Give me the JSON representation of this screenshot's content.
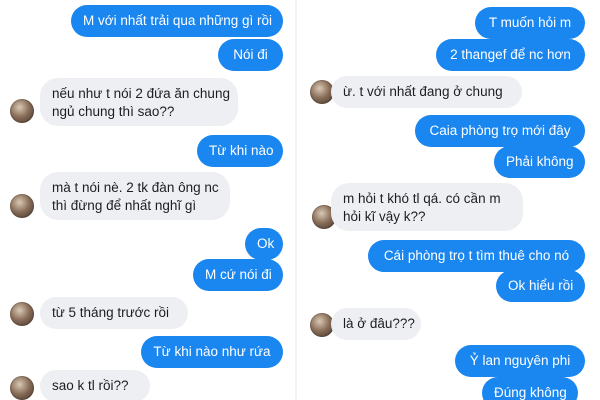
{
  "left_conversation": {
    "messages": [
      {
        "sender": "me",
        "text": "M với nhất trải qua những gì rồi"
      },
      {
        "sender": "me",
        "text": "Nói đi"
      },
      {
        "sender": "them",
        "lines": [
          "nếu như t nói 2 đứa ăn chung",
          "ngủ chung thì sao??"
        ]
      },
      {
        "sender": "me",
        "text": "Từ khi nào"
      },
      {
        "sender": "them",
        "lines": [
          "mà t nói nè. 2 tk đàn ông nc",
          "thì đừng để nhất nghĩ gì"
        ]
      },
      {
        "sender": "me",
        "text": "Ok"
      },
      {
        "sender": "me",
        "text": "M cứ nói đi"
      },
      {
        "sender": "them",
        "text": "từ 5 tháng trước rồi"
      },
      {
        "sender": "me",
        "text": "Từ khi nào như rứa"
      },
      {
        "sender": "them",
        "text": "sao k tl rồi??"
      }
    ]
  },
  "right_conversation": {
    "messages": [
      {
        "sender": "me",
        "text": "T muốn hỏi m"
      },
      {
        "sender": "me",
        "text": "2 thangef để nc hơn"
      },
      {
        "sender": "them",
        "text": "ừ. t với nhất đang ở chung"
      },
      {
        "sender": "me",
        "text": "Caia phòng trọ mới đây"
      },
      {
        "sender": "me",
        "text": "Phải không"
      },
      {
        "sender": "them",
        "lines": [
          "m hỏi t khó tl qá. có cần m",
          "hỏi kĩ vậy k??"
        ]
      },
      {
        "sender": "me",
        "text": "Cái phòng trọ t tìm thuê cho nó"
      },
      {
        "sender": "me",
        "text": "Ok hiểu rồi"
      },
      {
        "sender": "them",
        "text": "là ở đâu???"
      },
      {
        "sender": "me",
        "text": "Ỷ lan nguyên phi"
      },
      {
        "sender": "me",
        "text": "Đúng không"
      }
    ]
  },
  "colors": {
    "outgoing_bubble": "#1a86f0",
    "incoming_bubble": "#eeeff2",
    "outgoing_text": "#ffffff",
    "incoming_text": "#1c1e21"
  }
}
